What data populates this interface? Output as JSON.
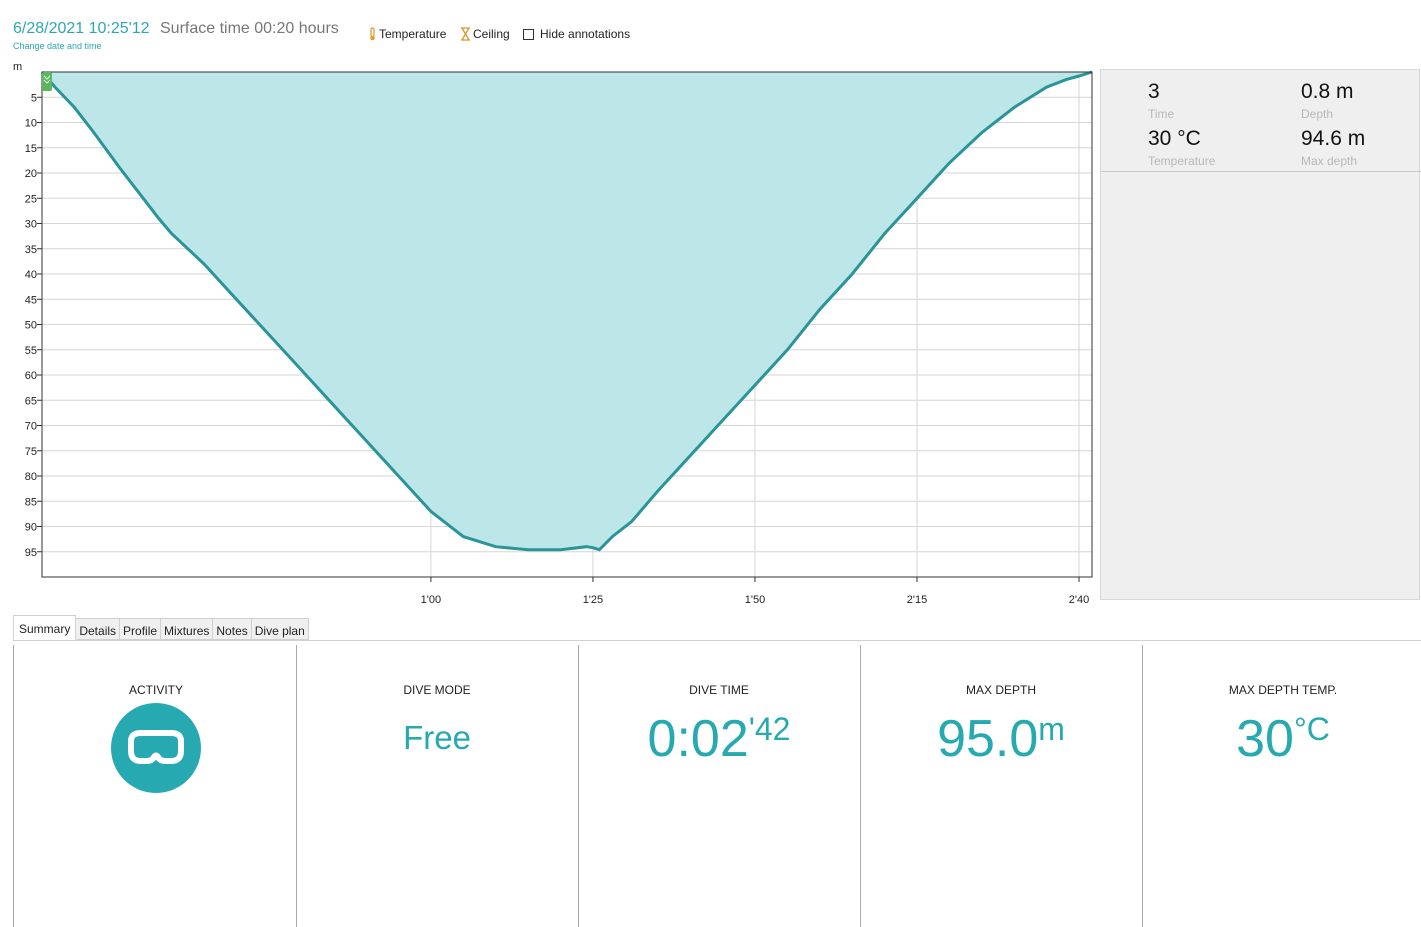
{
  "header": {
    "date_time": "6/28/2021 10:25'12",
    "surface_time": "Surface time 00:20 hours",
    "change_link": "Change date and time",
    "toggles": {
      "temperature": "Temperature",
      "ceiling": "Ceiling",
      "hide_annotations": "Hide annotations",
      "hide_annotations_checked": false
    }
  },
  "chart_data": {
    "type": "area",
    "y_unit_label": "m",
    "y_ticks": [
      5,
      10,
      15,
      20,
      25,
      30,
      35,
      40,
      45,
      50,
      55,
      60,
      65,
      70,
      75,
      80,
      85,
      90,
      95
    ],
    "ylim": [
      0,
      100
    ],
    "y_inverted": true,
    "x_tick_labels": [
      "1'00",
      "1'25",
      "1'50",
      "2'15",
      "2'40"
    ],
    "x_tick_seconds": [
      60,
      85,
      110,
      135,
      160
    ],
    "xlim": [
      0,
      162
    ],
    "grid": true,
    "series": [
      {
        "values_x_seconds": [
          0,
          2,
          5,
          8,
          12,
          18,
          20,
          25,
          30,
          35,
          40,
          45,
          50,
          55,
          60,
          65,
          70,
          75,
          80,
          84,
          85,
          86,
          88,
          91,
          95,
          100,
          105,
          110,
          115,
          120,
          125,
          130,
          135,
          140,
          145,
          150,
          155,
          158,
          160,
          162
        ],
        "values_depth_m": [
          0,
          3,
          7,
          12,
          19,
          29,
          32,
          38,
          45,
          52,
          59,
          66,
          73,
          80,
          87,
          92,
          94,
          94.6,
          94.6,
          94,
          94.2,
          94.6,
          92,
          89,
          83,
          76,
          69,
          62,
          55,
          47,
          40,
          32,
          25,
          18,
          12,
          7,
          3,
          1.5,
          0.8,
          0
        ]
      }
    ],
    "fill_color": "#bde6e9",
    "line_color": "#2a9499"
  },
  "info": {
    "time_value": "3",
    "time_label": "Time",
    "depth_value": "0.8 m",
    "depth_label": "Depth",
    "temp_value": "30 °C",
    "temp_label": "Temperature",
    "maxdepth_value": "94.6 m",
    "maxdepth_label": "Max depth"
  },
  "tabs": [
    "Summary",
    "Details",
    "Profile",
    "Mixtures",
    "Notes",
    "Dive plan"
  ],
  "active_tab": "Summary",
  "summary": {
    "activity_title": "ACTIVITY",
    "activity_icon": "snorkel-mask-icon",
    "mode_title": "DIVE MODE",
    "mode_value": "Free",
    "time_title": "DIVE TIME",
    "time_main": "0:02",
    "time_sup": "'42",
    "depth_title": "MAX DEPTH",
    "depth_main": "95.0",
    "depth_sup": "m",
    "temp_title": "MAX DEPTH TEMP.",
    "temp_main": "30",
    "temp_sup": "°C",
    "accent_color": "#26a9b1"
  }
}
